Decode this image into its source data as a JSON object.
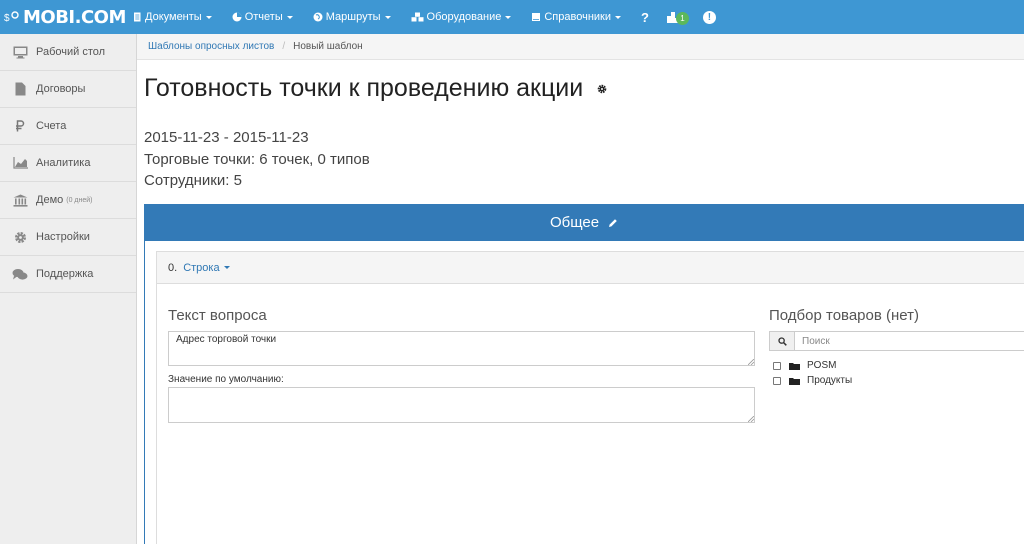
{
  "navbar": {
    "brand": "MOBI.COM",
    "items": [
      {
        "label": "Документы",
        "icon": "document-icon"
      },
      {
        "label": "Отчеты",
        "icon": "pie-chart-icon"
      },
      {
        "label": "Маршруты",
        "icon": "globe-icon"
      },
      {
        "label": "Оборудование",
        "icon": "cubes-icon"
      },
      {
        "label": "Справочники",
        "icon": "book-icon"
      }
    ],
    "help_label": "?",
    "notifications_count": "1",
    "alert_label": "!"
  },
  "sidebar": {
    "items": [
      {
        "label": "Рабочий стол",
        "icon": "desktop-icon"
      },
      {
        "label": "Договоры",
        "icon": "file-icon"
      },
      {
        "label": "Счета",
        "icon": "ruble-icon"
      },
      {
        "label": "Аналитика",
        "icon": "area-chart-icon"
      },
      {
        "label": "Демо",
        "suffix": "(0 дней)",
        "icon": "bank-icon"
      },
      {
        "label": "Настройки",
        "icon": "gear-icon"
      },
      {
        "label": "Поддержка",
        "icon": "comments-icon"
      }
    ]
  },
  "breadcrumb": {
    "parent": "Шаблоны опросных листов",
    "separator": "/",
    "current": "Новый шаблон"
  },
  "page": {
    "title": "Готовность точки к проведению акции",
    "dates": "2015-11-23 - 2015-11-23",
    "points": "Торговые точки: 6 точек, 0 типов",
    "employees": "Сотрудники: 5"
  },
  "panel": {
    "title": "Общее",
    "row_index": "0.",
    "row_label": "Строка",
    "question_label": "Текст вопроса",
    "question_value": "Адрес торговой точки",
    "default_label": "Значение по умолчанию:",
    "default_value": "",
    "goods_label": "Подбор товаров  (нет)",
    "search_placeholder": "Поиск",
    "tree": [
      {
        "label": "POSM"
      },
      {
        "label": "Продукты"
      }
    ]
  },
  "colors": {
    "navbar": "#3e97d3",
    "panel_header": "#337ab7",
    "link": "#3078b4",
    "badge": "#5cb85c"
  }
}
